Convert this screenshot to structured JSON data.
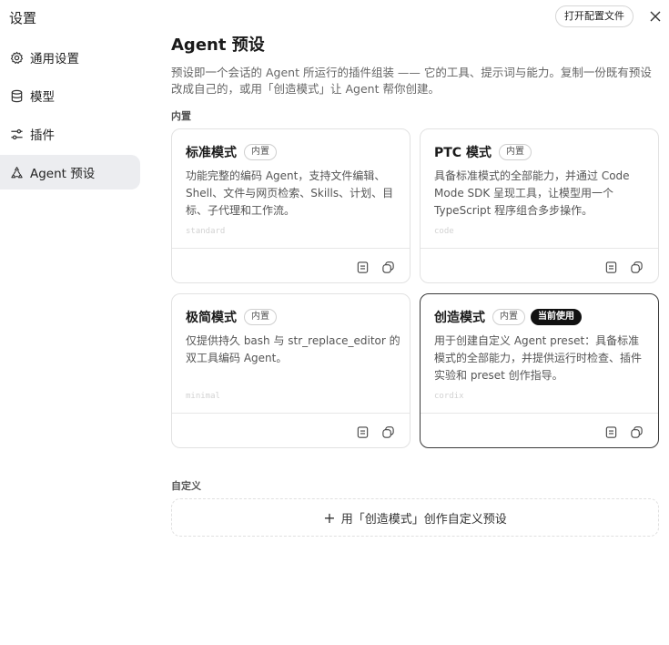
{
  "window": {
    "title": "设置"
  },
  "sidebar": {
    "items": [
      {
        "label": "通用设置",
        "icon": "gear-icon",
        "active": false
      },
      {
        "label": "模型",
        "icon": "database-icon",
        "active": false
      },
      {
        "label": "插件",
        "icon": "sliders-icon",
        "active": false
      },
      {
        "label": "Agent 预设",
        "icon": "agent-preset-icon",
        "active": true
      }
    ]
  },
  "header": {
    "open_config_label": "打开配置文件",
    "close_icon": "close-icon"
  },
  "main": {
    "title": "Agent 预设",
    "description": "预设即一个会话的 Agent 所运行的插件组装 —— 它的工具、提示词与能力。复制一份既有预设改成自己的，或用「创造模式」让 Agent 帮你创建。",
    "builtin_label": "内置",
    "custom_label": "自定义",
    "create_custom_label": "用「创造模式」创作自定义预设",
    "presets": [
      {
        "name": "标准模式",
        "badge": "内置",
        "description": "功能完整的编码 Agent，支持文件编辑、Shell、文件与网页检索、Skills、计划、目标、子代理和工作流。",
        "id": "standard",
        "current_badge": ""
      },
      {
        "name": "PTC 模式",
        "badge": "内置",
        "description": "具备标准模式的全部能力，并通过 Code Mode SDK 呈现工具，让模型用一个 TypeScript 程序组合多步操作。",
        "id": "code",
        "current_badge": ""
      },
      {
        "name": "极简模式",
        "badge": "内置",
        "description": "仅提供持久 bash 与 str_replace_editor 的双工具编码 Agent。",
        "id": "minimal",
        "current_badge": ""
      },
      {
        "name": "创造模式",
        "badge": "内置",
        "description": "用于创建自定义 Agent preset：具备标准模式的全部能力，并提供运行时检查、插件实验和 preset 创作指导。",
        "id": "cordix",
        "current_badge": "当前使用"
      }
    ]
  },
  "colors": {
    "selected_border": "#3a3a3a",
    "active_nav_bg": "#ecedf0",
    "current_badge_bg": "#111111"
  }
}
